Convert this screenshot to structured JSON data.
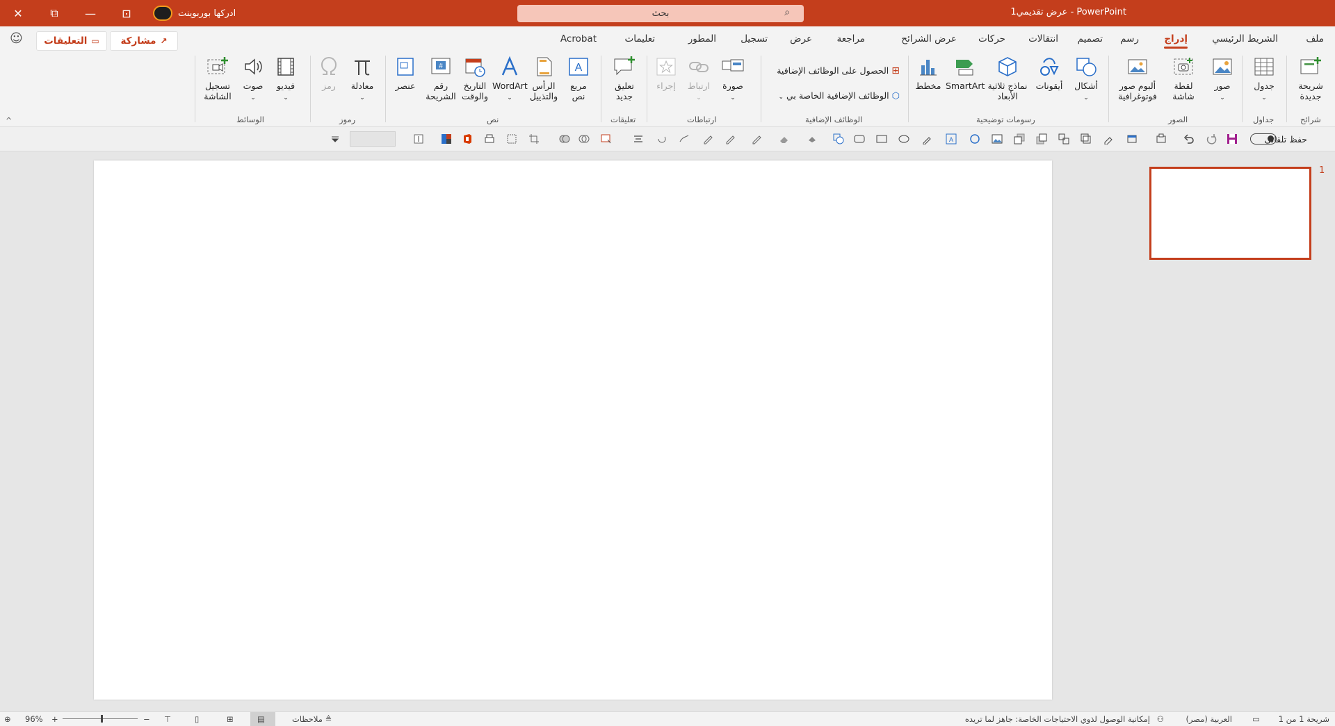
{
  "window": {
    "doc_title": "عرض تقديمي1  -  PowerPoint",
    "user_name": "ادركها بوربوينت",
    "search_placeholder": "بحث",
    "close_glyph": "✕",
    "restore_glyph": "⧉",
    "minimize_glyph": "—",
    "ribbon_display_glyph": "⊡"
  },
  "tabs": [
    {
      "label": "ملف"
    },
    {
      "label": "الشريط الرئيسي"
    },
    {
      "label": "إدراج",
      "active": true
    },
    {
      "label": "رسم"
    },
    {
      "label": "تصميم"
    },
    {
      "label": "انتقالات"
    },
    {
      "label": "حركات"
    },
    {
      "label": "عرض الشرائح"
    },
    {
      "label": "مراجعة"
    },
    {
      "label": "عرض"
    },
    {
      "label": "تسجيل"
    },
    {
      "label": "المطور"
    },
    {
      "label": "تعليمات"
    },
    {
      "label": "Acrobat"
    }
  ],
  "header_actions": {
    "share": "مشاركة",
    "comments": "التعليقات"
  },
  "ribbon": {
    "groups": {
      "slides": "شرائح",
      "tables": "جداول",
      "images": "الصور",
      "illustrations": "رسومات توضيحية",
      "addins": "الوظائف الإضافية",
      "links": "ارتباطات",
      "comments": "تعليقات",
      "text": "نص",
      "symbols": "رموز",
      "media": "الوسائط"
    },
    "buttons": {
      "new_slide": [
        "شريحة",
        "جديدة"
      ],
      "table": "جدول",
      "pictures": "صور",
      "screenshot": [
        "لقطة",
        "شاشة"
      ],
      "photo_album": [
        "ألبوم صور",
        "فوتوغرافية"
      ],
      "shapes": "أشكال",
      "icons": "أيقونات",
      "models_3d": [
        "نماذج ثلاثية",
        "الأبعاد"
      ],
      "smartart": "SmartArt",
      "chart": "مخطط",
      "get_addins": "الحصول على الوظائف الإضافية",
      "my_addins": "الوظائف الإضافية الخاصة بي",
      "zoom": "صورة",
      "link": "ارتباط",
      "action": "إجراء",
      "new_comment": [
        "تعليق",
        "جديد"
      ],
      "text_box": [
        "مربع",
        "نص"
      ],
      "header_footer": [
        "الرأس",
        "والتذييل"
      ],
      "wordart": "WordArt",
      "date_time": [
        "التاريخ",
        "والوقت"
      ],
      "slide_number": [
        "رقم",
        "الشريحة"
      ],
      "object": "عنصر",
      "equation": "معادلة",
      "symbol": "رمز",
      "video": "فيديو",
      "audio": "صوت",
      "screen_recording": [
        "تسجيل",
        "الشاشة"
      ]
    }
  },
  "qat": {
    "autosave": "حفظ تلقائي"
  },
  "thumbnails": [
    {
      "number": "1"
    }
  ],
  "status": {
    "slide_count": "شريحة 1 من 1",
    "language": "العربية (مصر)",
    "accessibility": "إمكانية الوصول لذوي الاحتياجات الخاصة: جاهز لما تريده",
    "notes": "ملاحظات",
    "zoom": "96%",
    "zoom_plus": "+",
    "zoom_minus": "−"
  },
  "colors": {
    "accent": "#c43e1c",
    "ribbon_bg": "#f3f3f3",
    "canvas_bg": "#e6e6e6"
  }
}
